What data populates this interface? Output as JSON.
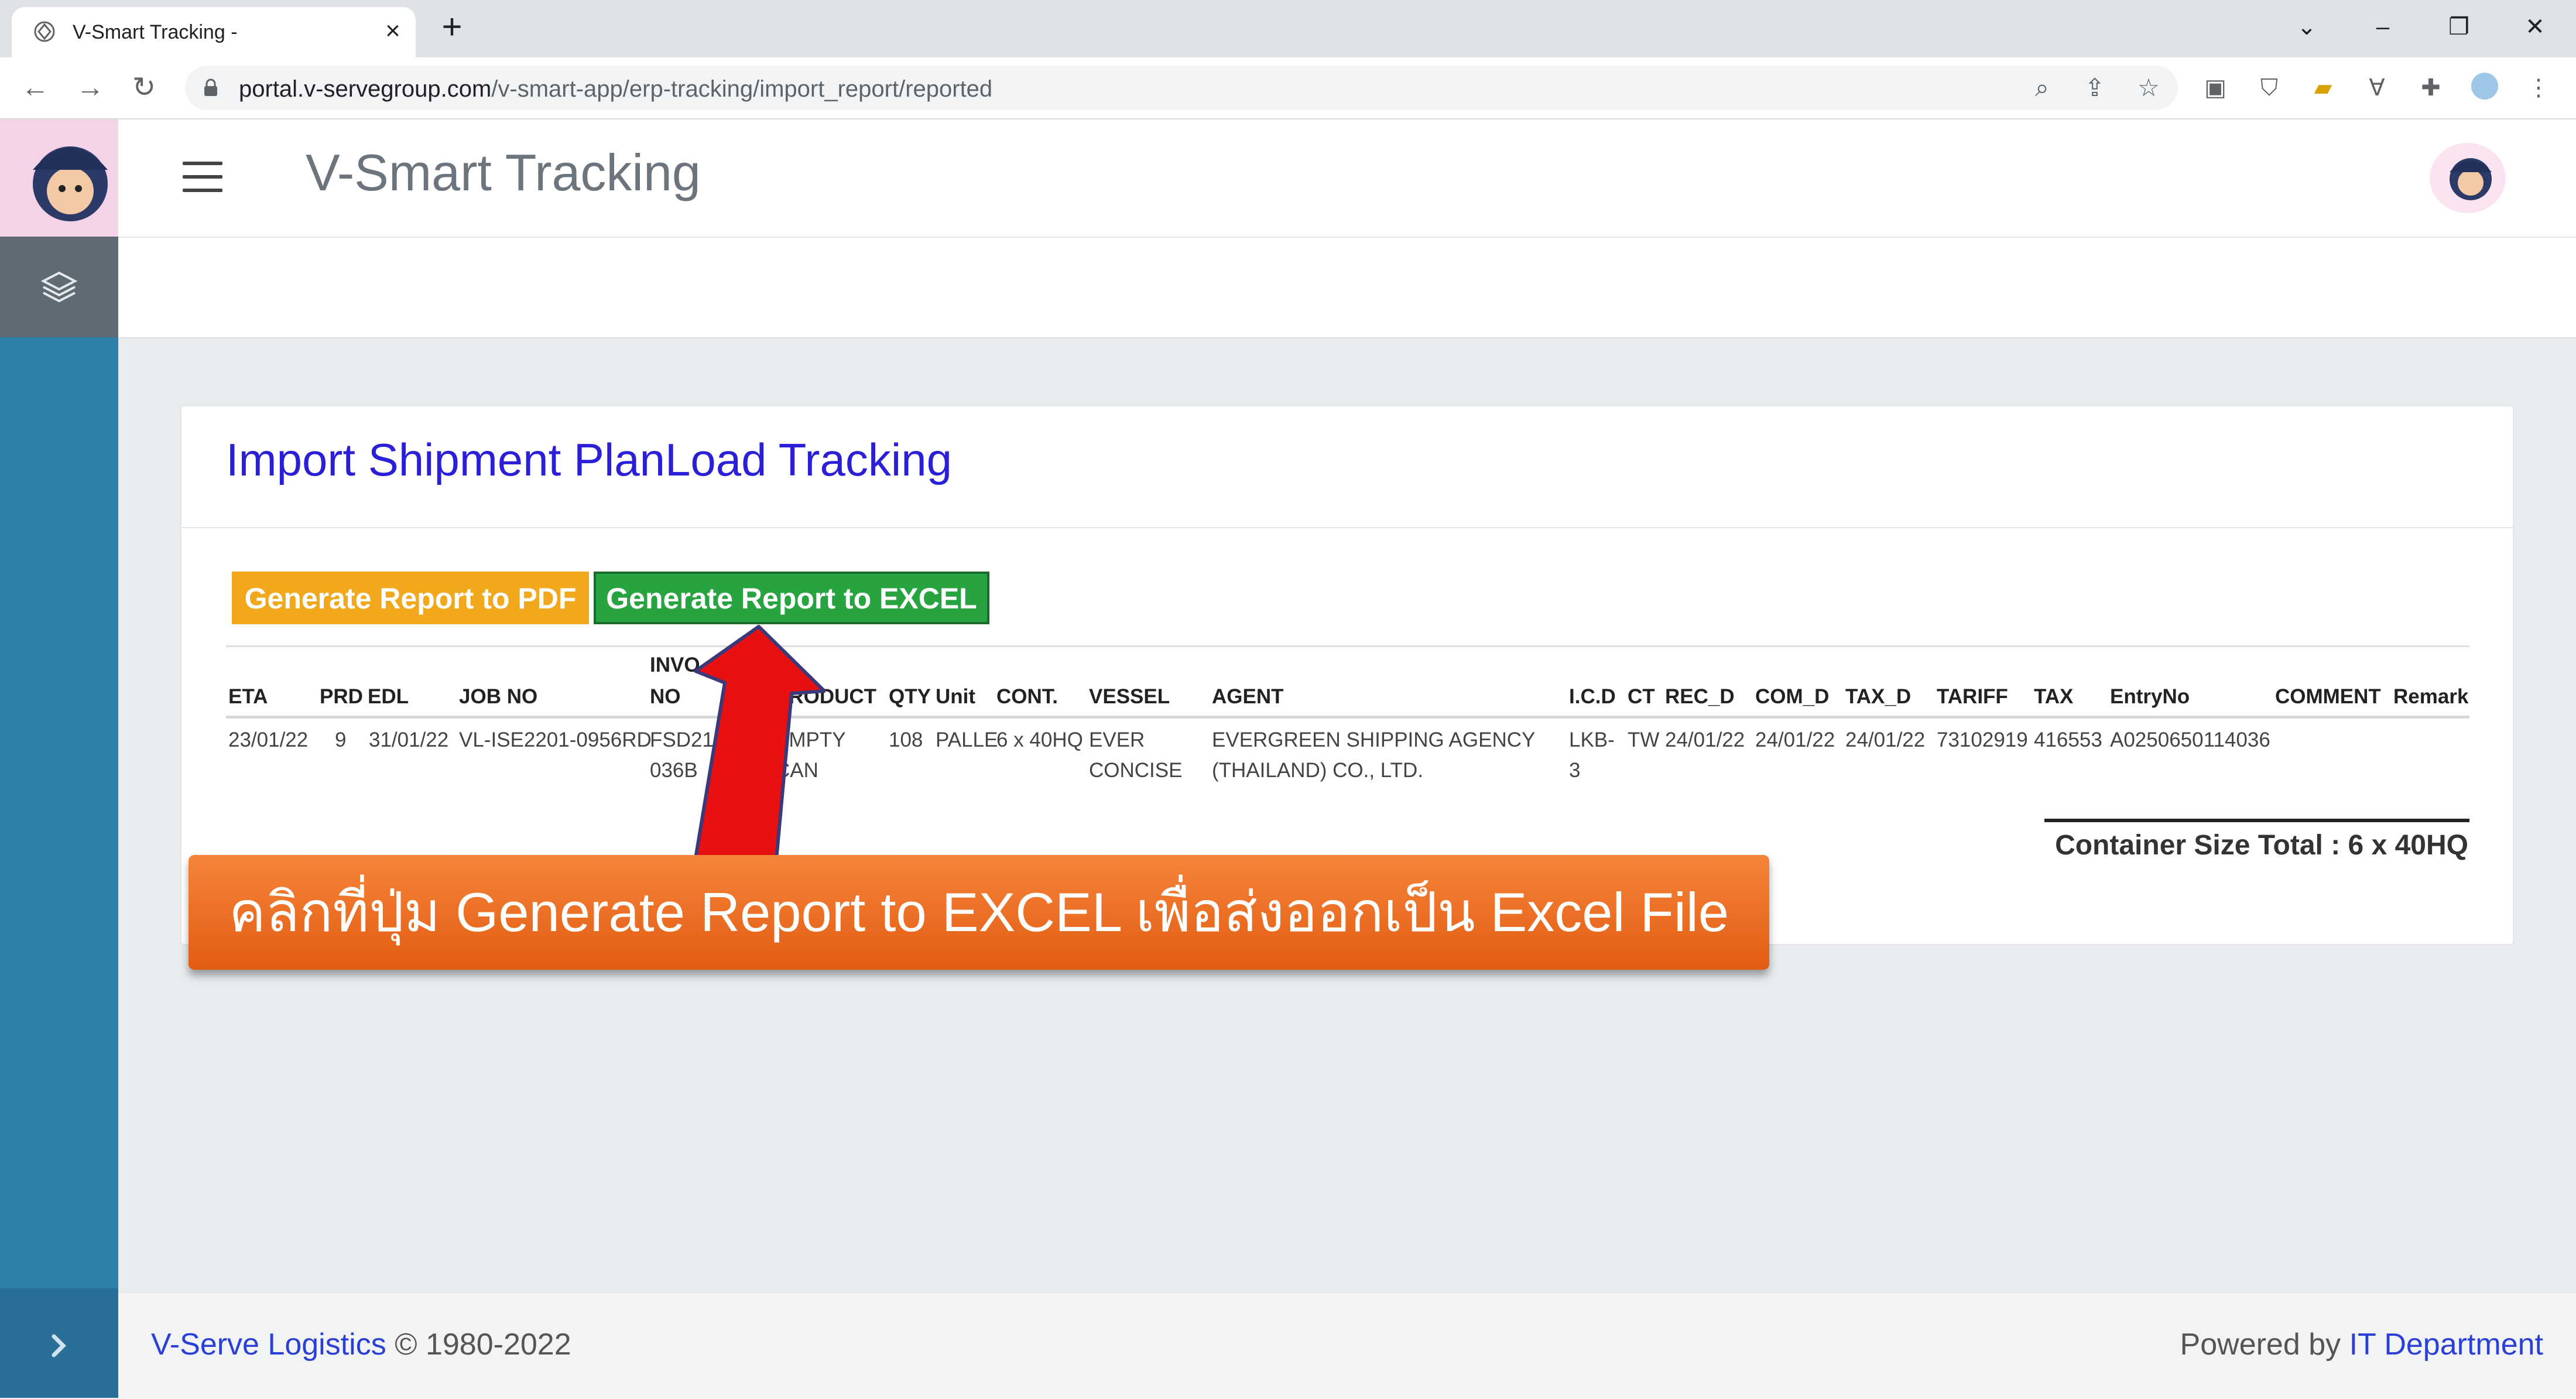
{
  "browser": {
    "tab_title": "V-Smart Tracking -",
    "url_host": "portal.v-servegroup.com",
    "url_path": "/v-smart-app/erp-tracking/import_report/reported"
  },
  "app": {
    "title": "V-Smart Tracking"
  },
  "card": {
    "title": "Import Shipment PlanLoad Tracking",
    "btn_pdf": "Generate Report to PDF",
    "btn_excel": "Generate Report to EXCEL"
  },
  "table": {
    "headers": {
      "eta": "ETA",
      "prd": "PRD",
      "edl": "EDL",
      "job_no": "JOB NO",
      "invoice_1": "INVO",
      "invoice_2": "NO",
      "product": "PRODUCT",
      "qty": "QTY",
      "unit": "Unit",
      "cont": "CONT.",
      "vessel": "VESSEL",
      "agent": "AGENT",
      "icd": "I.C.D",
      "ct": "CT",
      "rec_d": "REC_D",
      "com_d": "COM_D",
      "tax_d": "TAX_D",
      "tariff": "TARIFF",
      "tax": "TAX",
      "entry_no": "EntryNo",
      "comment": "COMMENT",
      "remark": "Remark"
    },
    "row": {
      "eta": "23/01/22",
      "prd": "9",
      "edl": "31/01/22",
      "job_no": "VL-ISE2201-0956RD",
      "invoice_1": "FSD21",
      "invoice_2": "036B",
      "product_1": "EMPTY",
      "product_2": "CAN",
      "qty": "108",
      "unit": "PALLE",
      "cont": "6 x 40HQ",
      "vessel_1": "EVER",
      "vessel_2": "CONCISE",
      "agent_1": "EVERGREEN SHIPPING AGENCY",
      "agent_2": "(THAILAND) CO., LTD.",
      "icd_1": "LKB-",
      "icd_2": "3",
      "ct": "TW",
      "rec_d": "24/01/22",
      "com_d": "24/01/22",
      "tax_d": "24/01/22",
      "tariff": "73102919",
      "tax": "416553",
      "entry_no": "A0250650114036"
    },
    "total": "Container Size Total : 6 x 40HQ"
  },
  "annotation": {
    "text": "คลิกที่ปุ่ม Generate Report to EXCEL เพื่อส่งออกเป็น Excel File"
  },
  "footer": {
    "brand": "V-Serve Logistics",
    "copyright": "© 1980-2022",
    "powered_prefix": "Powered by",
    "powered_link": "IT Department"
  },
  "icons": [
    "tab-favicon-icon",
    "close-icon",
    "plus-icon",
    "back-icon",
    "forward-icon",
    "reload-icon",
    "lock-icon",
    "zoom-icon",
    "share-icon",
    "star-icon",
    "extension-icon",
    "menu-icon",
    "layers-icon",
    "chevron-right-icon"
  ],
  "colors": {
    "sidebar": "#2f7fab",
    "title_blue": "#2a1fd6",
    "pdf_button": "#f2a81d",
    "excel_button": "#27a33f",
    "annotation": "#ee6f22",
    "arrow": "#e81010"
  }
}
